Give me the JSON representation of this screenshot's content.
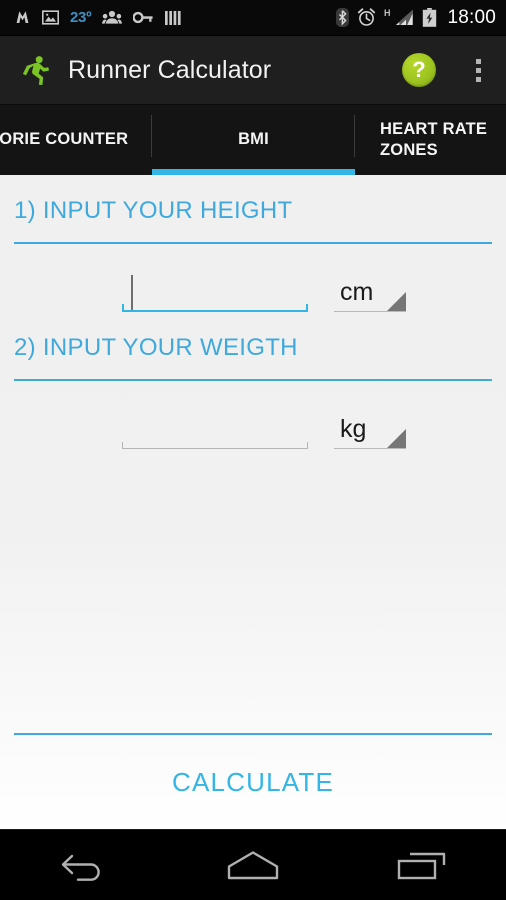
{
  "status_bar": {
    "temperature": "23º",
    "clock": "18:00",
    "left_icons": [
      {
        "name": "mail-m-icon"
      },
      {
        "name": "photo-image-icon"
      },
      {
        "name": "people-group-icon"
      },
      {
        "name": "key-icon"
      },
      {
        "name": "bars-icon"
      }
    ],
    "right_icons": [
      {
        "name": "bluetooth-icon"
      },
      {
        "name": "alarm-clock-icon"
      },
      {
        "name": "signal-bars-icon",
        "label": "H"
      },
      {
        "name": "battery-charging-icon"
      }
    ]
  },
  "action_bar": {
    "title": "Runner Calculator",
    "app_icon": "runner-icon",
    "help_label": "?",
    "help_icon": "help-question-icon",
    "overflow_icon": "overflow-menu-icon"
  },
  "tabs": [
    {
      "label": "LORIE COUNTER",
      "full_label": "CALORIE COUNTER",
      "selected": false
    },
    {
      "label": "BMI",
      "selected": true
    },
    {
      "label": "HEART RATE ZONES",
      "selected": false
    }
  ],
  "theme": {
    "accent_blue": "#33b5e5",
    "title_blue": "#3fa9dd",
    "accent_green": "#9ec520",
    "action_bar_bg": "#1f1f1f",
    "content_bg": "#f0f0f0"
  },
  "form": {
    "height_section": {
      "title": "1) INPUT YOUR HEIGHT",
      "value": "",
      "placeholder": "",
      "unit": "cm",
      "focused": true
    },
    "weight_section": {
      "title": "2) INPUT YOUR WEIGTH",
      "value": "",
      "placeholder": "",
      "unit": "kg",
      "focused": false
    },
    "calculate_label": "CALCULATE"
  },
  "nav_bar": {
    "back": "back-icon",
    "home": "home-icon",
    "recents": "recents-icon"
  }
}
